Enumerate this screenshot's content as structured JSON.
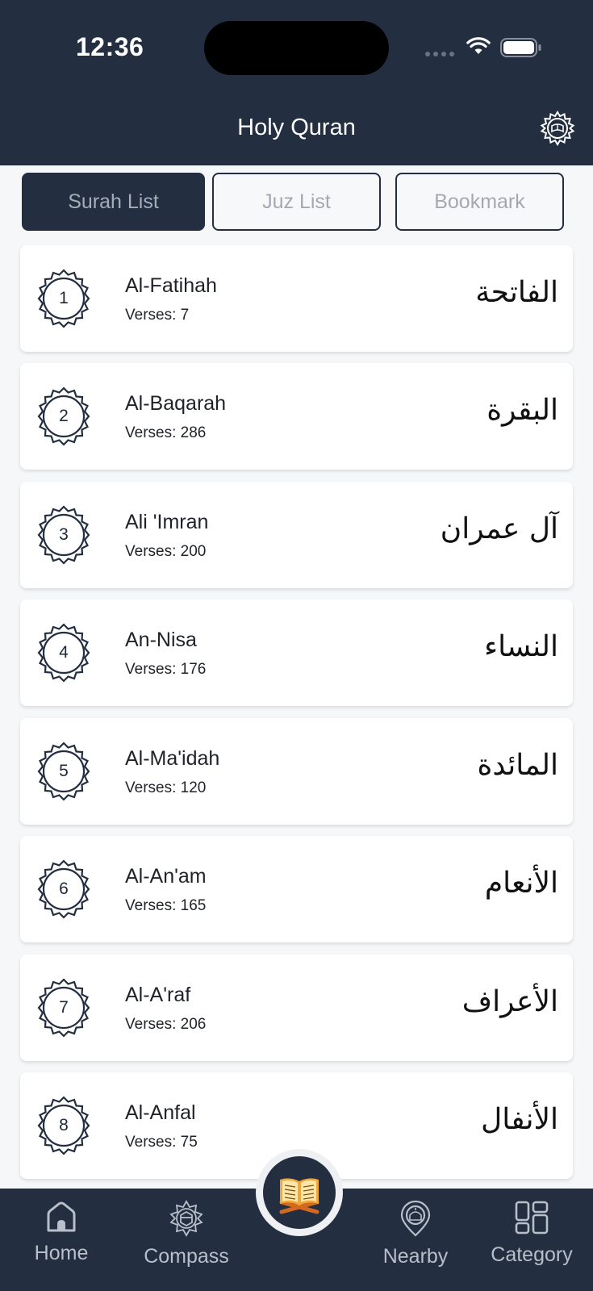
{
  "status_bar": {
    "time": "12:36"
  },
  "header": {
    "title": "Holy Quran",
    "settings_icon": "gear-quran-icon"
  },
  "tabs": [
    {
      "label": "Surah List",
      "active": true
    },
    {
      "label": "Juz List",
      "active": false
    },
    {
      "label": "Bookmark",
      "active": false
    }
  ],
  "surahs": [
    {
      "number": "1",
      "name": "Al-Fatihah",
      "verses": "Verses: 7",
      "arabic": "الفاتحة"
    },
    {
      "number": "2",
      "name": "Al-Baqarah",
      "verses": "Verses: 286",
      "arabic": "البقرة"
    },
    {
      "number": "3",
      "name": "Ali 'Imran",
      "verses": "Verses: 200",
      "arabic": "آل عمران"
    },
    {
      "number": "4",
      "name": "An-Nisa",
      "verses": "Verses: 176",
      "arabic": "النساء"
    },
    {
      "number": "5",
      "name": "Al-Ma'idah",
      "verses": "Verses: 120",
      "arabic": "المائدة"
    },
    {
      "number": "6",
      "name": "Al-An'am",
      "verses": "Verses: 165",
      "arabic": "الأنعام"
    },
    {
      "number": "7",
      "name": "Al-A'raf",
      "verses": "Verses: 206",
      "arabic": "الأعراف"
    },
    {
      "number": "8",
      "name": "Al-Anfal",
      "verses": "Verses: 75",
      "arabic": "الأنفال"
    }
  ],
  "bottom_nav": [
    {
      "label": "Home",
      "icon": "home-icon"
    },
    {
      "label": "Compass",
      "icon": "compass-kaaba-icon"
    },
    {
      "label": "",
      "icon": "quran-book-icon"
    },
    {
      "label": "Nearby",
      "icon": "mosque-location-icon"
    },
    {
      "label": "Category",
      "icon": "category-grid-icon"
    }
  ],
  "colors": {
    "primary": "#232e41",
    "background": "#f6f7f9",
    "card": "#ffffff"
  }
}
